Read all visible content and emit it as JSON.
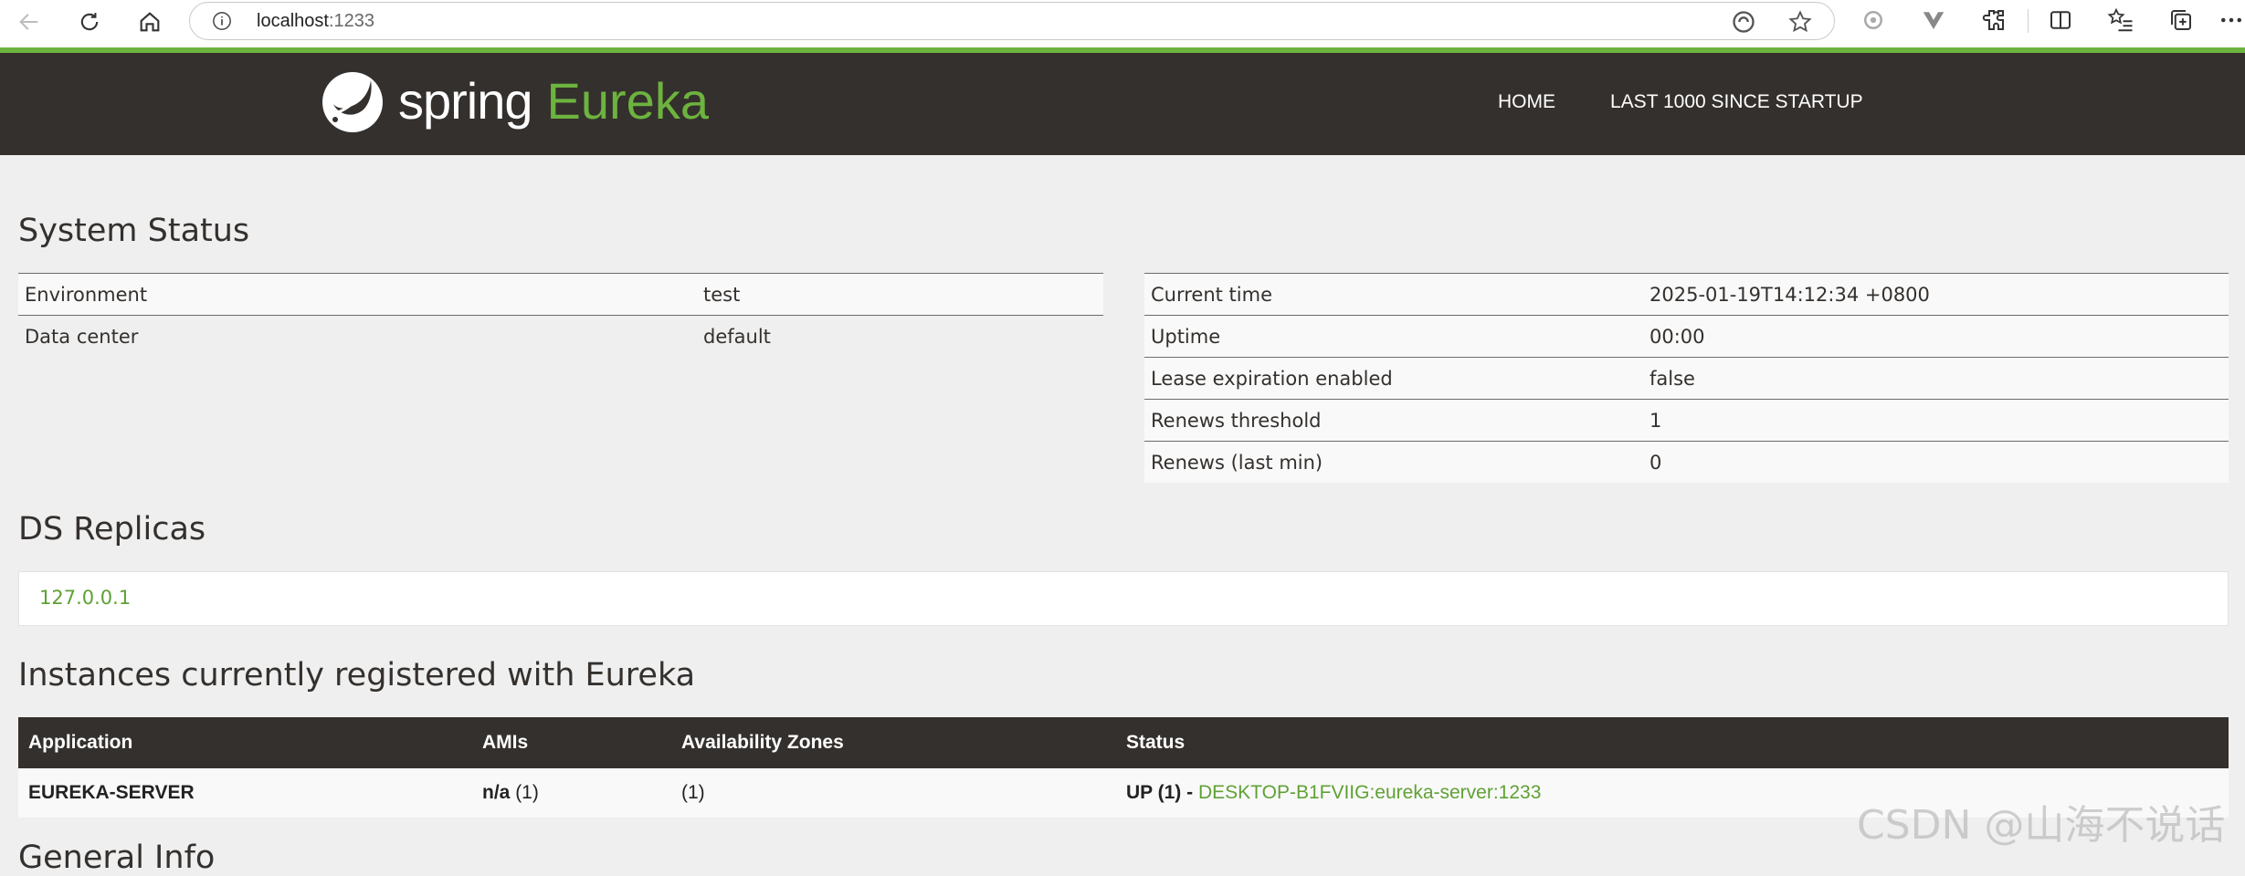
{
  "browser": {
    "url_host": "localhost",
    "url_port": ":1233"
  },
  "header": {
    "logo_spring": "spring",
    "logo_eureka": "Eureka",
    "nav_home": "HOME",
    "nav_last": "LAST 1000 SINCE STARTUP"
  },
  "system_status": {
    "title": "System Status",
    "left": [
      {
        "label": "Environment",
        "value": "test"
      },
      {
        "label": "Data center",
        "value": "default"
      }
    ],
    "right": [
      {
        "label": "Current time",
        "value": "2025-01-19T14:12:34 +0800"
      },
      {
        "label": "Uptime",
        "value": "00:00"
      },
      {
        "label": "Lease expiration enabled",
        "value": "false"
      },
      {
        "label": "Renews threshold",
        "value": "1"
      },
      {
        "label": "Renews (last min)",
        "value": "0"
      }
    ]
  },
  "ds_replicas": {
    "title": "DS Replicas",
    "items": [
      "127.0.0.1"
    ]
  },
  "instances": {
    "title": "Instances currently registered with Eureka",
    "columns": [
      "Application",
      "AMIs",
      "Availability Zones",
      "Status"
    ],
    "rows": [
      {
        "application": "EUREKA-SERVER",
        "amis_bold": "n/a",
        "amis_count": "(1)",
        "zones": "(1)",
        "status_prefix": "UP (1) -",
        "status_link": "DESKTOP-B1FVIIG:eureka-server:1233"
      }
    ]
  },
  "next_section_title": "General Info",
  "watermark": "CSDN @山海不说话",
  "colors": {
    "brand_green": "#6db33f",
    "header_dark": "#34302d",
    "page_bg": "#efefef"
  }
}
